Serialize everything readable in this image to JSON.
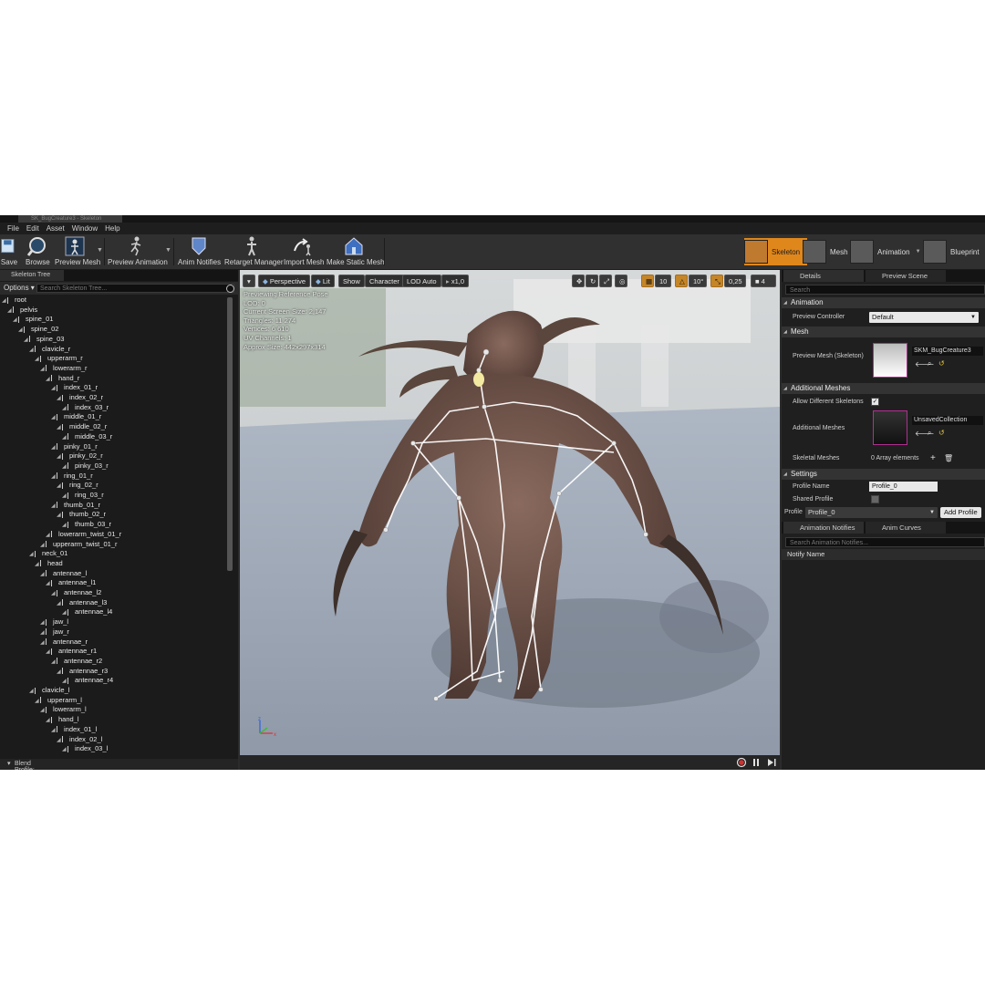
{
  "window": {
    "tab_title": "SK_BugCreature3 - Skeleton"
  },
  "menu": [
    "File",
    "Edit",
    "Asset",
    "Window",
    "Help"
  ],
  "toolbar": {
    "save": "Save",
    "browse": "Browse",
    "preview_mesh": "Preview Mesh",
    "preview_animation": "Preview Animation",
    "anim_notifies": "Anim Notifies",
    "retarget_manager": "Retarget Manager",
    "import_mesh": "Import Mesh",
    "make_static_mesh": "Make Static Mesh"
  },
  "modes": {
    "skeleton": "Skeleton",
    "mesh": "Mesh",
    "animation": "Animation",
    "blueprint": "Blueprint"
  },
  "skeleton_tree": {
    "tab": "Skeleton Tree",
    "options": "Options",
    "search_placeholder": "Search Skeleton Tree...",
    "blend_profile": "Blend Profile: None",
    "bones": [
      {
        "name": "root",
        "depth": 0
      },
      {
        "name": "pelvis",
        "depth": 1
      },
      {
        "name": "spine_01",
        "depth": 2
      },
      {
        "name": "spine_02",
        "depth": 3
      },
      {
        "name": "spine_03",
        "depth": 4
      },
      {
        "name": "clavicle_r",
        "depth": 5
      },
      {
        "name": "upperarm_r",
        "depth": 6
      },
      {
        "name": "lowerarm_r",
        "depth": 7
      },
      {
        "name": "hand_r",
        "depth": 8
      },
      {
        "name": "index_01_r",
        "depth": 9
      },
      {
        "name": "index_02_r",
        "depth": 10
      },
      {
        "name": "index_03_r",
        "depth": 11
      },
      {
        "name": "middle_01_r",
        "depth": 9
      },
      {
        "name": "middle_02_r",
        "depth": 10
      },
      {
        "name": "middle_03_r",
        "depth": 11
      },
      {
        "name": "pinky_01_r",
        "depth": 9
      },
      {
        "name": "pinky_02_r",
        "depth": 10
      },
      {
        "name": "pinky_03_r",
        "depth": 11
      },
      {
        "name": "ring_01_r",
        "depth": 9
      },
      {
        "name": "ring_02_r",
        "depth": 10
      },
      {
        "name": "ring_03_r",
        "depth": 11
      },
      {
        "name": "thumb_01_r",
        "depth": 9
      },
      {
        "name": "thumb_02_r",
        "depth": 10
      },
      {
        "name": "thumb_03_r",
        "depth": 11
      },
      {
        "name": "lowerarm_twist_01_r",
        "depth": 8
      },
      {
        "name": "upperarm_twist_01_r",
        "depth": 7
      },
      {
        "name": "neck_01",
        "depth": 5
      },
      {
        "name": "head",
        "depth": 6
      },
      {
        "name": "antennae_l",
        "depth": 7
      },
      {
        "name": "antennae_l1",
        "depth": 8
      },
      {
        "name": "antennae_l2",
        "depth": 9
      },
      {
        "name": "antennae_l3",
        "depth": 10
      },
      {
        "name": "antennae_l4",
        "depth": 11
      },
      {
        "name": "jaw_l",
        "depth": 7
      },
      {
        "name": "jaw_r",
        "depth": 7
      },
      {
        "name": "antennae_r",
        "depth": 7
      },
      {
        "name": "antennae_r1",
        "depth": 8
      },
      {
        "name": "antennae_r2",
        "depth": 9
      },
      {
        "name": "antennae_r3",
        "depth": 10
      },
      {
        "name": "antennae_r4",
        "depth": 11
      },
      {
        "name": "clavicle_l",
        "depth": 5
      },
      {
        "name": "upperarm_l",
        "depth": 6
      },
      {
        "name": "lowerarm_l",
        "depth": 7
      },
      {
        "name": "hand_l",
        "depth": 8
      },
      {
        "name": "index_01_l",
        "depth": 9
      },
      {
        "name": "index_02_l",
        "depth": 10
      },
      {
        "name": "index_03_l",
        "depth": 11
      }
    ]
  },
  "viewport": {
    "perspective": "Perspective",
    "lit": "Lit",
    "show": "Show",
    "character": "Character",
    "lod": "LOD Auto",
    "speed": "x1,0",
    "grid_snap": "10",
    "rot_snap": "10°",
    "scale_snap": "0,25",
    "camera_speed": "4",
    "stats": [
      "Previewing Reference Pose",
      "LOD: 0",
      "Current Screen Size: 2,147",
      "Triangles: 11 274",
      "Vertices: 6 610",
      "UV Channels: 1",
      "Approx Size: 442x297x314"
    ]
  },
  "details": {
    "tab_details": "Details",
    "tab_preview": "Preview Scene Sett...",
    "search_placeholder": "Search",
    "sections": {
      "animation": "Animation",
      "mesh": "Mesh",
      "additional_meshes": "Additional Meshes",
      "settings": "Settings"
    },
    "preview_controller_label": "Preview Controller",
    "preview_controller_value": "Default",
    "preview_mesh_label": "Preview Mesh (Skeleton)",
    "preview_mesh_value": "SKM_BugCreature3",
    "allow_diff_label": "Allow Different Skeletons",
    "additional_meshes_label": "Additional Meshes",
    "additional_meshes_value": "UnsavedCollection",
    "skeletal_meshes_label": "Skeletal Meshes",
    "skeletal_meshes_value": "0 Array elements",
    "profile_name_label": "Profile Name",
    "profile_name_value": "Profile_0",
    "shared_profile_label": "Shared Profile",
    "profile_label": "Profile",
    "profile_value": "Profile_0",
    "add_profile": "Add Profile"
  },
  "notifies": {
    "tab_notifies": "Animation Notifies",
    "tab_curves": "Anim Curves",
    "search_placeholder": "Search Animation Notifies...",
    "header": "Notify Name"
  }
}
